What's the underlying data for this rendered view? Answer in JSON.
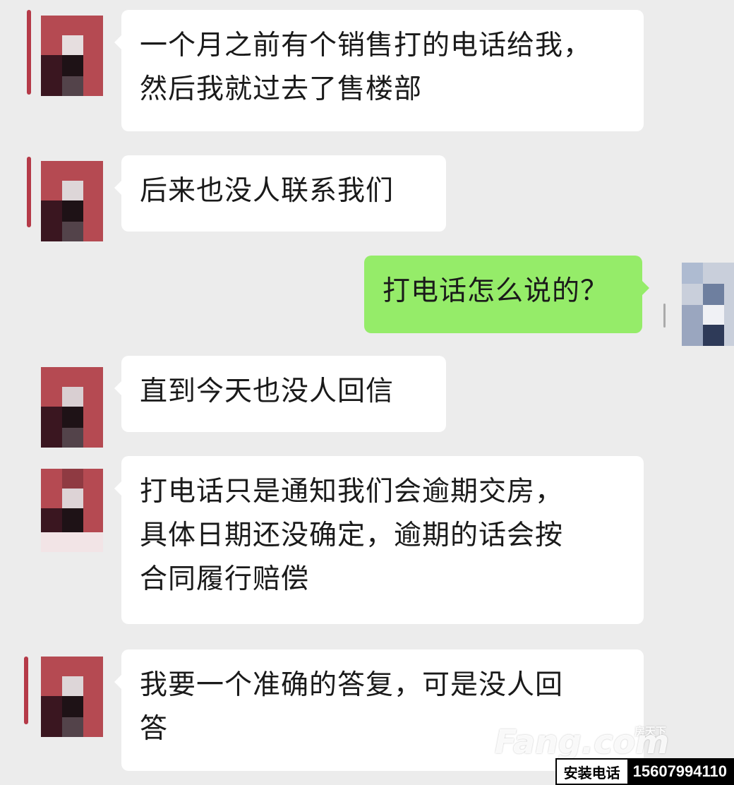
{
  "messages": [
    {
      "side": "left",
      "text": "一个月之前有个销售打的电话给我，\n然后我就过去了售楼部"
    },
    {
      "side": "left",
      "text": "后来也没人联系我们"
    },
    {
      "side": "right",
      "text": "打电话怎么说的？"
    },
    {
      "side": "left",
      "text": "直到今天也没人回信"
    },
    {
      "side": "left",
      "text": "打电话只是通知我们会逾期交房，\n具体日期还没确定，逾期的话会按\n合同履行赔偿"
    },
    {
      "side": "left",
      "text": "我要一个准确的答复，可是没人回\n答"
    }
  ],
  "colors": {
    "background": "#ececec",
    "bubble_left": "#ffffff",
    "bubble_right": "#95ec69"
  },
  "watermark": {
    "small": "房天下",
    "large": "Fang.com"
  },
  "install": {
    "label": "安装电话",
    "number": "15607994110"
  }
}
